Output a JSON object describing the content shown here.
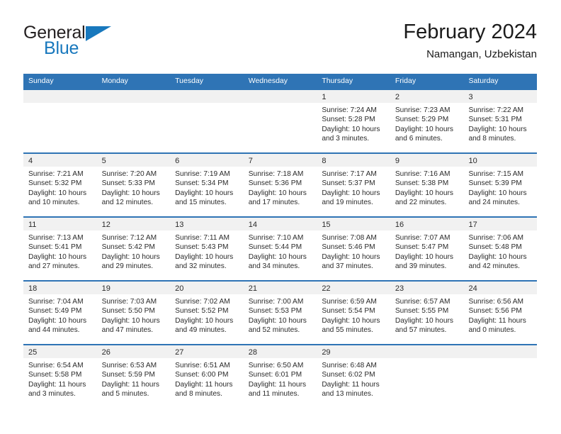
{
  "brand": {
    "name_part1": "General",
    "name_part2": "Blue",
    "accent_color": "#1878bd"
  },
  "header": {
    "title": "February 2024",
    "subtitle": "Namangan, Uzbekistan"
  },
  "calendar": {
    "header_color": "#2f74b5",
    "day_band_color": "#f1f1f1",
    "weekdays": [
      "Sunday",
      "Monday",
      "Tuesday",
      "Wednesday",
      "Thursday",
      "Friday",
      "Saturday"
    ],
    "weeks": [
      [
        {
          "day": "",
          "sunrise": "",
          "sunset": "",
          "daylight1": "",
          "daylight2": ""
        },
        {
          "day": "",
          "sunrise": "",
          "sunset": "",
          "daylight1": "",
          "daylight2": ""
        },
        {
          "day": "",
          "sunrise": "",
          "sunset": "",
          "daylight1": "",
          "daylight2": ""
        },
        {
          "day": "",
          "sunrise": "",
          "sunset": "",
          "daylight1": "",
          "daylight2": ""
        },
        {
          "day": "1",
          "sunrise": "Sunrise: 7:24 AM",
          "sunset": "Sunset: 5:28 PM",
          "daylight1": "Daylight: 10 hours",
          "daylight2": "and 3 minutes."
        },
        {
          "day": "2",
          "sunrise": "Sunrise: 7:23 AM",
          "sunset": "Sunset: 5:29 PM",
          "daylight1": "Daylight: 10 hours",
          "daylight2": "and 6 minutes."
        },
        {
          "day": "3",
          "sunrise": "Sunrise: 7:22 AM",
          "sunset": "Sunset: 5:31 PM",
          "daylight1": "Daylight: 10 hours",
          "daylight2": "and 8 minutes."
        }
      ],
      [
        {
          "day": "4",
          "sunrise": "Sunrise: 7:21 AM",
          "sunset": "Sunset: 5:32 PM",
          "daylight1": "Daylight: 10 hours",
          "daylight2": "and 10 minutes."
        },
        {
          "day": "5",
          "sunrise": "Sunrise: 7:20 AM",
          "sunset": "Sunset: 5:33 PM",
          "daylight1": "Daylight: 10 hours",
          "daylight2": "and 12 minutes."
        },
        {
          "day": "6",
          "sunrise": "Sunrise: 7:19 AM",
          "sunset": "Sunset: 5:34 PM",
          "daylight1": "Daylight: 10 hours",
          "daylight2": "and 15 minutes."
        },
        {
          "day": "7",
          "sunrise": "Sunrise: 7:18 AM",
          "sunset": "Sunset: 5:36 PM",
          "daylight1": "Daylight: 10 hours",
          "daylight2": "and 17 minutes."
        },
        {
          "day": "8",
          "sunrise": "Sunrise: 7:17 AM",
          "sunset": "Sunset: 5:37 PM",
          "daylight1": "Daylight: 10 hours",
          "daylight2": "and 19 minutes."
        },
        {
          "day": "9",
          "sunrise": "Sunrise: 7:16 AM",
          "sunset": "Sunset: 5:38 PM",
          "daylight1": "Daylight: 10 hours",
          "daylight2": "and 22 minutes."
        },
        {
          "day": "10",
          "sunrise": "Sunrise: 7:15 AM",
          "sunset": "Sunset: 5:39 PM",
          "daylight1": "Daylight: 10 hours",
          "daylight2": "and 24 minutes."
        }
      ],
      [
        {
          "day": "11",
          "sunrise": "Sunrise: 7:13 AM",
          "sunset": "Sunset: 5:41 PM",
          "daylight1": "Daylight: 10 hours",
          "daylight2": "and 27 minutes."
        },
        {
          "day": "12",
          "sunrise": "Sunrise: 7:12 AM",
          "sunset": "Sunset: 5:42 PM",
          "daylight1": "Daylight: 10 hours",
          "daylight2": "and 29 minutes."
        },
        {
          "day": "13",
          "sunrise": "Sunrise: 7:11 AM",
          "sunset": "Sunset: 5:43 PM",
          "daylight1": "Daylight: 10 hours",
          "daylight2": "and 32 minutes."
        },
        {
          "day": "14",
          "sunrise": "Sunrise: 7:10 AM",
          "sunset": "Sunset: 5:44 PM",
          "daylight1": "Daylight: 10 hours",
          "daylight2": "and 34 minutes."
        },
        {
          "day": "15",
          "sunrise": "Sunrise: 7:08 AM",
          "sunset": "Sunset: 5:46 PM",
          "daylight1": "Daylight: 10 hours",
          "daylight2": "and 37 minutes."
        },
        {
          "day": "16",
          "sunrise": "Sunrise: 7:07 AM",
          "sunset": "Sunset: 5:47 PM",
          "daylight1": "Daylight: 10 hours",
          "daylight2": "and 39 minutes."
        },
        {
          "day": "17",
          "sunrise": "Sunrise: 7:06 AM",
          "sunset": "Sunset: 5:48 PM",
          "daylight1": "Daylight: 10 hours",
          "daylight2": "and 42 minutes."
        }
      ],
      [
        {
          "day": "18",
          "sunrise": "Sunrise: 7:04 AM",
          "sunset": "Sunset: 5:49 PM",
          "daylight1": "Daylight: 10 hours",
          "daylight2": "and 44 minutes."
        },
        {
          "day": "19",
          "sunrise": "Sunrise: 7:03 AM",
          "sunset": "Sunset: 5:50 PM",
          "daylight1": "Daylight: 10 hours",
          "daylight2": "and 47 minutes."
        },
        {
          "day": "20",
          "sunrise": "Sunrise: 7:02 AM",
          "sunset": "Sunset: 5:52 PM",
          "daylight1": "Daylight: 10 hours",
          "daylight2": "and 49 minutes."
        },
        {
          "day": "21",
          "sunrise": "Sunrise: 7:00 AM",
          "sunset": "Sunset: 5:53 PM",
          "daylight1": "Daylight: 10 hours",
          "daylight2": "and 52 minutes."
        },
        {
          "day": "22",
          "sunrise": "Sunrise: 6:59 AM",
          "sunset": "Sunset: 5:54 PM",
          "daylight1": "Daylight: 10 hours",
          "daylight2": "and 55 minutes."
        },
        {
          "day": "23",
          "sunrise": "Sunrise: 6:57 AM",
          "sunset": "Sunset: 5:55 PM",
          "daylight1": "Daylight: 10 hours",
          "daylight2": "and 57 minutes."
        },
        {
          "day": "24",
          "sunrise": "Sunrise: 6:56 AM",
          "sunset": "Sunset: 5:56 PM",
          "daylight1": "Daylight: 11 hours",
          "daylight2": "and 0 minutes."
        }
      ],
      [
        {
          "day": "25",
          "sunrise": "Sunrise: 6:54 AM",
          "sunset": "Sunset: 5:58 PM",
          "daylight1": "Daylight: 11 hours",
          "daylight2": "and 3 minutes."
        },
        {
          "day": "26",
          "sunrise": "Sunrise: 6:53 AM",
          "sunset": "Sunset: 5:59 PM",
          "daylight1": "Daylight: 11 hours",
          "daylight2": "and 5 minutes."
        },
        {
          "day": "27",
          "sunrise": "Sunrise: 6:51 AM",
          "sunset": "Sunset: 6:00 PM",
          "daylight1": "Daylight: 11 hours",
          "daylight2": "and 8 minutes."
        },
        {
          "day": "28",
          "sunrise": "Sunrise: 6:50 AM",
          "sunset": "Sunset: 6:01 PM",
          "daylight1": "Daylight: 11 hours",
          "daylight2": "and 11 minutes."
        },
        {
          "day": "29",
          "sunrise": "Sunrise: 6:48 AM",
          "sunset": "Sunset: 6:02 PM",
          "daylight1": "Daylight: 11 hours",
          "daylight2": "and 13 minutes."
        },
        {
          "day": "",
          "sunrise": "",
          "sunset": "",
          "daylight1": "",
          "daylight2": ""
        },
        {
          "day": "",
          "sunrise": "",
          "sunset": "",
          "daylight1": "",
          "daylight2": ""
        }
      ]
    ]
  }
}
